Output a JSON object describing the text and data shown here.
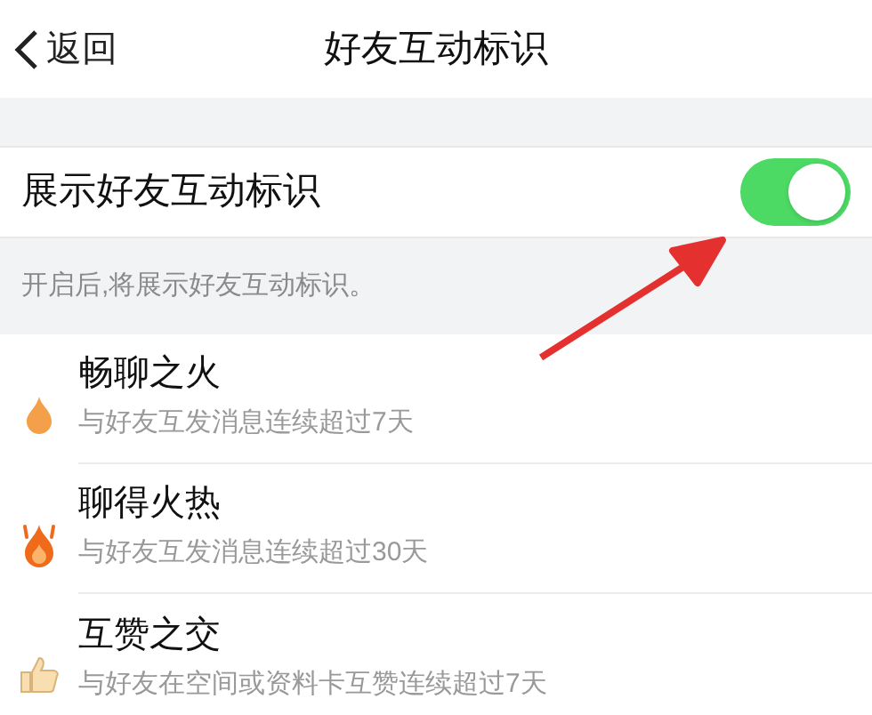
{
  "nav": {
    "back": "返回",
    "title": "好友互动标识"
  },
  "setting": {
    "label": "展示好友互动标识",
    "on": true,
    "hint": "开启后,将展示好友互动标识。"
  },
  "badges": [
    {
      "kind": "flame",
      "name": "畅聊之火",
      "desc": "与好友互发消息连续超过7天"
    },
    {
      "kind": "hotflame",
      "name": "聊得火热",
      "desc": "与好友互发消息连续超过30天"
    },
    {
      "kind": "thumb",
      "name": "互赞之交",
      "desc": "与好友在空间或资料卡互赞连续超过7天"
    }
  ]
}
